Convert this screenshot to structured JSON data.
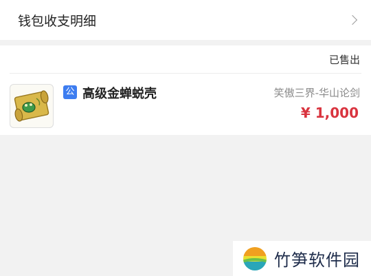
{
  "wallet": {
    "title": "钱包收支明细",
    "arrow_icon": "chevron-right-icon"
  },
  "order": {
    "status": "已售出",
    "badge": "公",
    "item_name": "高级金蝉蜕壳",
    "server": "笑傲三界-华山论剑",
    "price": "¥ 1,000",
    "price_color": "#d9343f",
    "thumb_icon": "scroll-item-icon"
  },
  "watermark": {
    "text": "竹笋软件园",
    "logo_icon": "bamboo-logo-icon"
  }
}
